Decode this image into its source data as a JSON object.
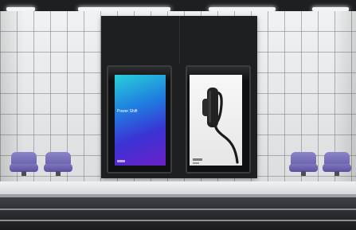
{
  "scene": {
    "description_tags": [],
    "colors": {
      "wall_tile": "#e9ebec",
      "panel": "#1e1f21",
      "bench": "#7d76bf",
      "poster_gradient_start": "#2ad0d8",
      "poster_gradient_end": "#6a20c7"
    }
  },
  "poster_left": {
    "title": "Power Shift",
    "list": [
      "",
      "",
      "",
      "",
      "",
      "",
      "",
      "",
      "",
      "",
      "",
      "",
      "",
      ""
    ]
  },
  "poster_right": {}
}
